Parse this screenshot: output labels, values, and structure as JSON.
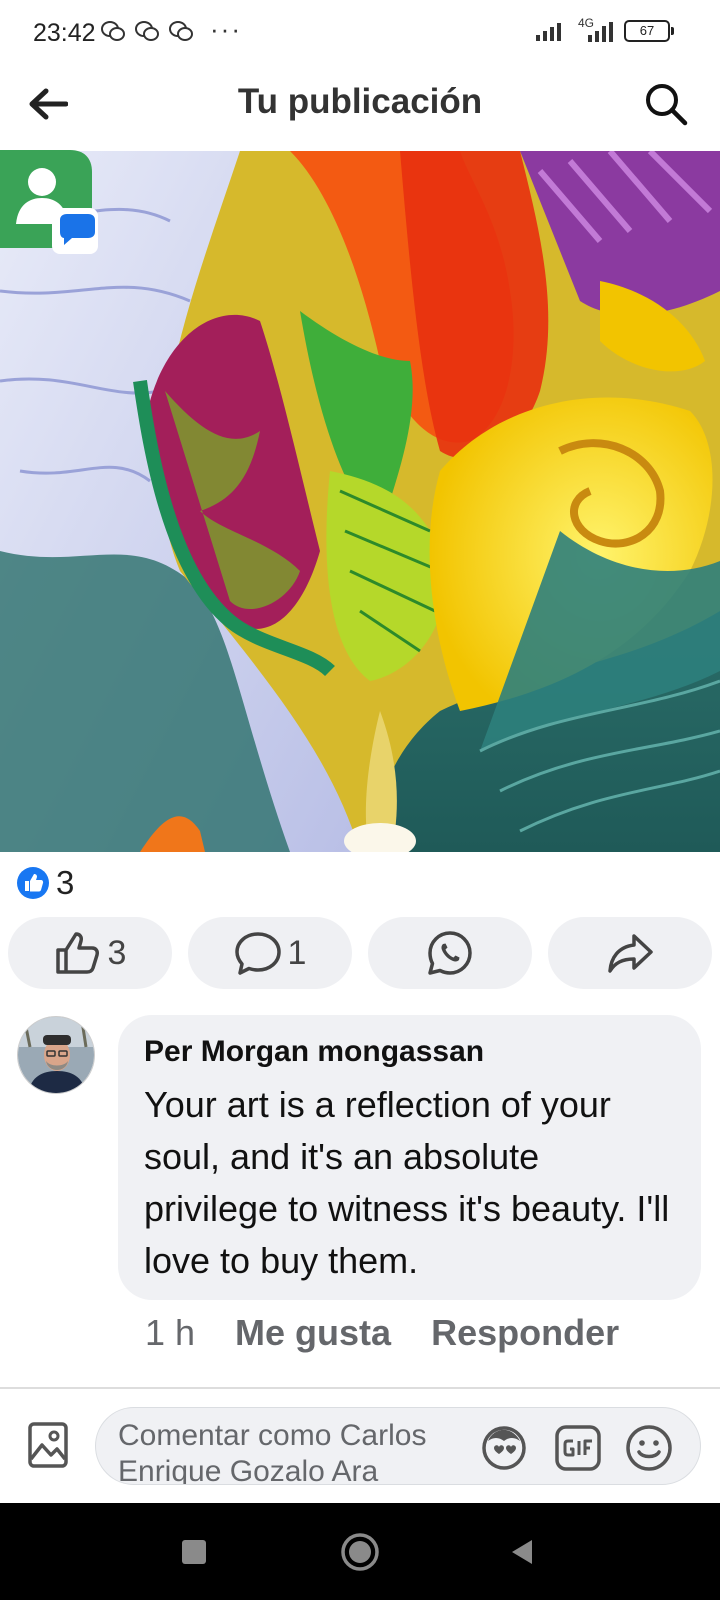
{
  "status_bar": {
    "time": "23:42",
    "dots": "···",
    "network": "4G",
    "battery": "67"
  },
  "header": {
    "title": "Tu publicación"
  },
  "post": {
    "reaction_count": "3",
    "like_count": "3",
    "comment_count": "1"
  },
  "comment": {
    "author": "Per Morgan mongassan",
    "text": "Your art is a reflection of your soul, and it's an absolute privilege to witness it's beauty. I'll love to buy them.",
    "time": "1 h",
    "like_label": "Me gusta",
    "reply_label": "Responder"
  },
  "composer": {
    "placeholder": "Comentar como Carlos Enrique Gozalo Ara"
  },
  "colors": {
    "facebook_blue": "#1877f2",
    "action_bg": "#eff0f3",
    "bubble_bg": "#f0f1f4",
    "secondary_text": "#65676b"
  }
}
